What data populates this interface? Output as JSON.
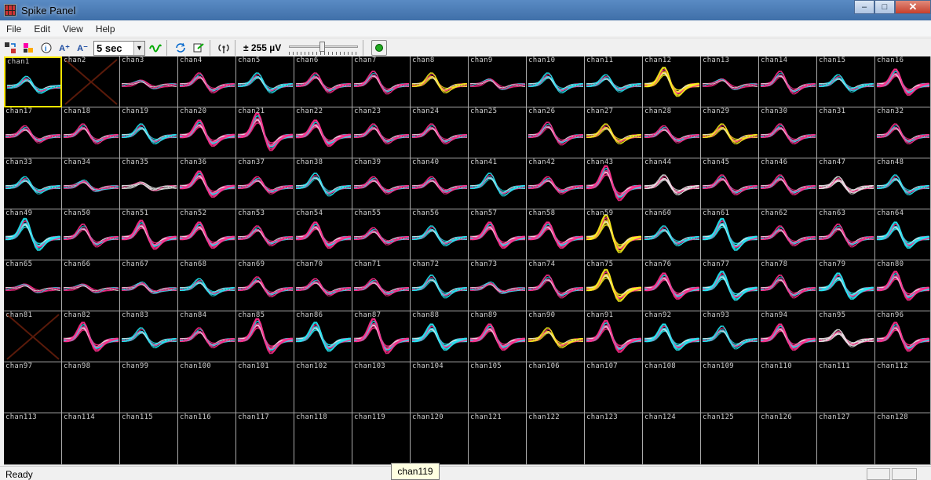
{
  "window": {
    "title": "Spike Panel",
    "minimize": "–",
    "maximize": "□",
    "close": "✕"
  },
  "menu": [
    "File",
    "Edit",
    "View",
    "Help"
  ],
  "toolbar": {
    "time_window": "5 sec",
    "range_label": "± 255 µV",
    "range_slider_level": 0.48,
    "icons": [
      "arrange-icon",
      "color-icon",
      "info-icon",
      "amplitude-up-icon",
      "amplitude-down-icon",
      "waveform-icon",
      "refresh-icon",
      "export-icon",
      "antenna-icon",
      "run-indicator-icon"
    ],
    "up_label": "A⁺",
    "down_label": "A⁻"
  },
  "grid": {
    "columns": 16,
    "rows": 8,
    "selected_channel": "chan1",
    "disabled_channels": [
      "chan2",
      "chan81"
    ]
  },
  "channels": [
    "chan1",
    "chan2",
    "chan3",
    "chan4",
    "chan5",
    "chan6",
    "chan7",
    "chan8",
    "chan9",
    "chan10",
    "chan11",
    "chan12",
    "chan13",
    "chan14",
    "chan15",
    "chan16",
    "chan17",
    "chan18",
    "chan19",
    "chan20",
    "chan21",
    "chan22",
    "chan23",
    "chan24",
    "chan25",
    "chan26",
    "chan27",
    "chan28",
    "chan29",
    "chan30",
    "chan31",
    "chan32",
    "chan33",
    "chan34",
    "chan35",
    "chan36",
    "chan37",
    "chan38",
    "chan39",
    "chan40",
    "chan41",
    "chan42",
    "chan43",
    "chan44",
    "chan45",
    "chan46",
    "chan47",
    "chan48",
    "chan49",
    "chan50",
    "chan51",
    "chan52",
    "chan53",
    "chan54",
    "chan55",
    "chan56",
    "chan57",
    "chan58",
    "chan59",
    "chan60",
    "chan61",
    "chan62",
    "chan63",
    "chan64",
    "chan65",
    "chan66",
    "chan67",
    "chan68",
    "chan69",
    "chan70",
    "chan71",
    "chan72",
    "chan73",
    "chan74",
    "chan75",
    "chan76",
    "chan77",
    "chan78",
    "chan79",
    "chan80",
    "chan81",
    "chan82",
    "chan83",
    "chan84",
    "chan85",
    "chan86",
    "chan87",
    "chan88",
    "chan89",
    "chan90",
    "chan91",
    "chan92",
    "chan93",
    "chan94",
    "chan95",
    "chan96",
    "chan97",
    "chan98",
    "chan99",
    "chan100",
    "chan101",
    "chan102",
    "chan103",
    "chan104",
    "chan105",
    "chan106",
    "chan107",
    "chan108",
    "chan109",
    "chan110",
    "chan111",
    "chan112",
    "chan113",
    "chan114",
    "chan115",
    "chan116",
    "chan117",
    "chan118",
    "chan119",
    "chan120",
    "chan121",
    "chan122",
    "chan123",
    "chan124",
    "chan125",
    "chan126",
    "chan127",
    "chan128"
  ],
  "colors": {
    "pink": "#ff2d8a",
    "cyan": "#21e6f2",
    "yellow": "#f7ee1a",
    "white": "#e8e8e8",
    "purple": "#8a2be2",
    "selection": "#ffe600",
    "disabled_x": "#5a1a0a"
  },
  "status": {
    "text": "Ready"
  },
  "tooltip": {
    "text": "chan119"
  }
}
